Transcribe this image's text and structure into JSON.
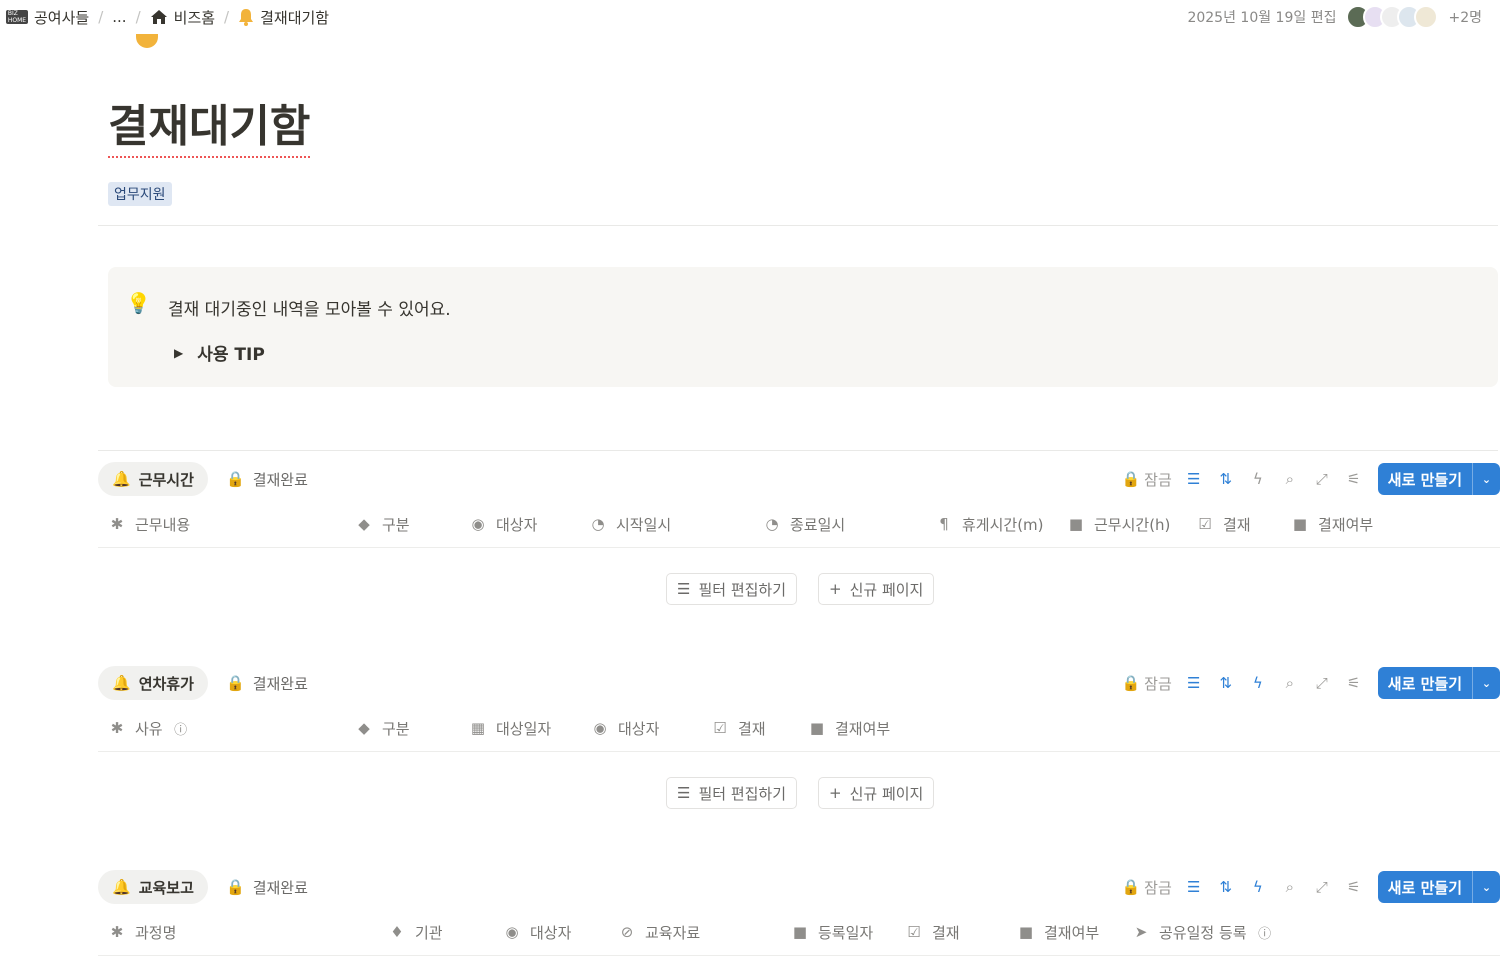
{
  "breadcrumb": {
    "workspace": "공여사들",
    "ellipsis": "...",
    "home": "비즈홈",
    "current": "결재대기함"
  },
  "header": {
    "edited": "2025년 10월 19일 편집",
    "more_users": "+2명"
  },
  "page": {
    "title": "결재대기함",
    "tag": "업무지원"
  },
  "callout": {
    "text": "결재 대기중인 내역을 모아볼 수 있어요.",
    "toggle": "사용 TIP"
  },
  "toolbar": {
    "lock_label": "잠금",
    "new_label": "새로 만들기"
  },
  "empty_actions": {
    "filter_edit": "필터 편집하기",
    "new_page": "신규 페이지"
  },
  "databases": [
    {
      "view": "근무시간",
      "view2": "결재완료",
      "columns": [
        "근무내용",
        "구분",
        "대상자",
        "시작일시",
        "종료일시",
        "휴게시간(m)",
        "근무시간(h)",
        "결재",
        "결재여부"
      ]
    },
    {
      "view": "연차휴가",
      "view2": "결재완료",
      "columns": [
        "사유",
        "구분",
        "대상일자",
        "대상자",
        "결재",
        "결재여부"
      ]
    },
    {
      "view": "교육보고",
      "view2": "결재완료",
      "columns": [
        "과정명",
        "기관",
        "대상자",
        "교육자료",
        "등록일자",
        "결재",
        "결재여부",
        "공유일정 등록"
      ]
    }
  ]
}
